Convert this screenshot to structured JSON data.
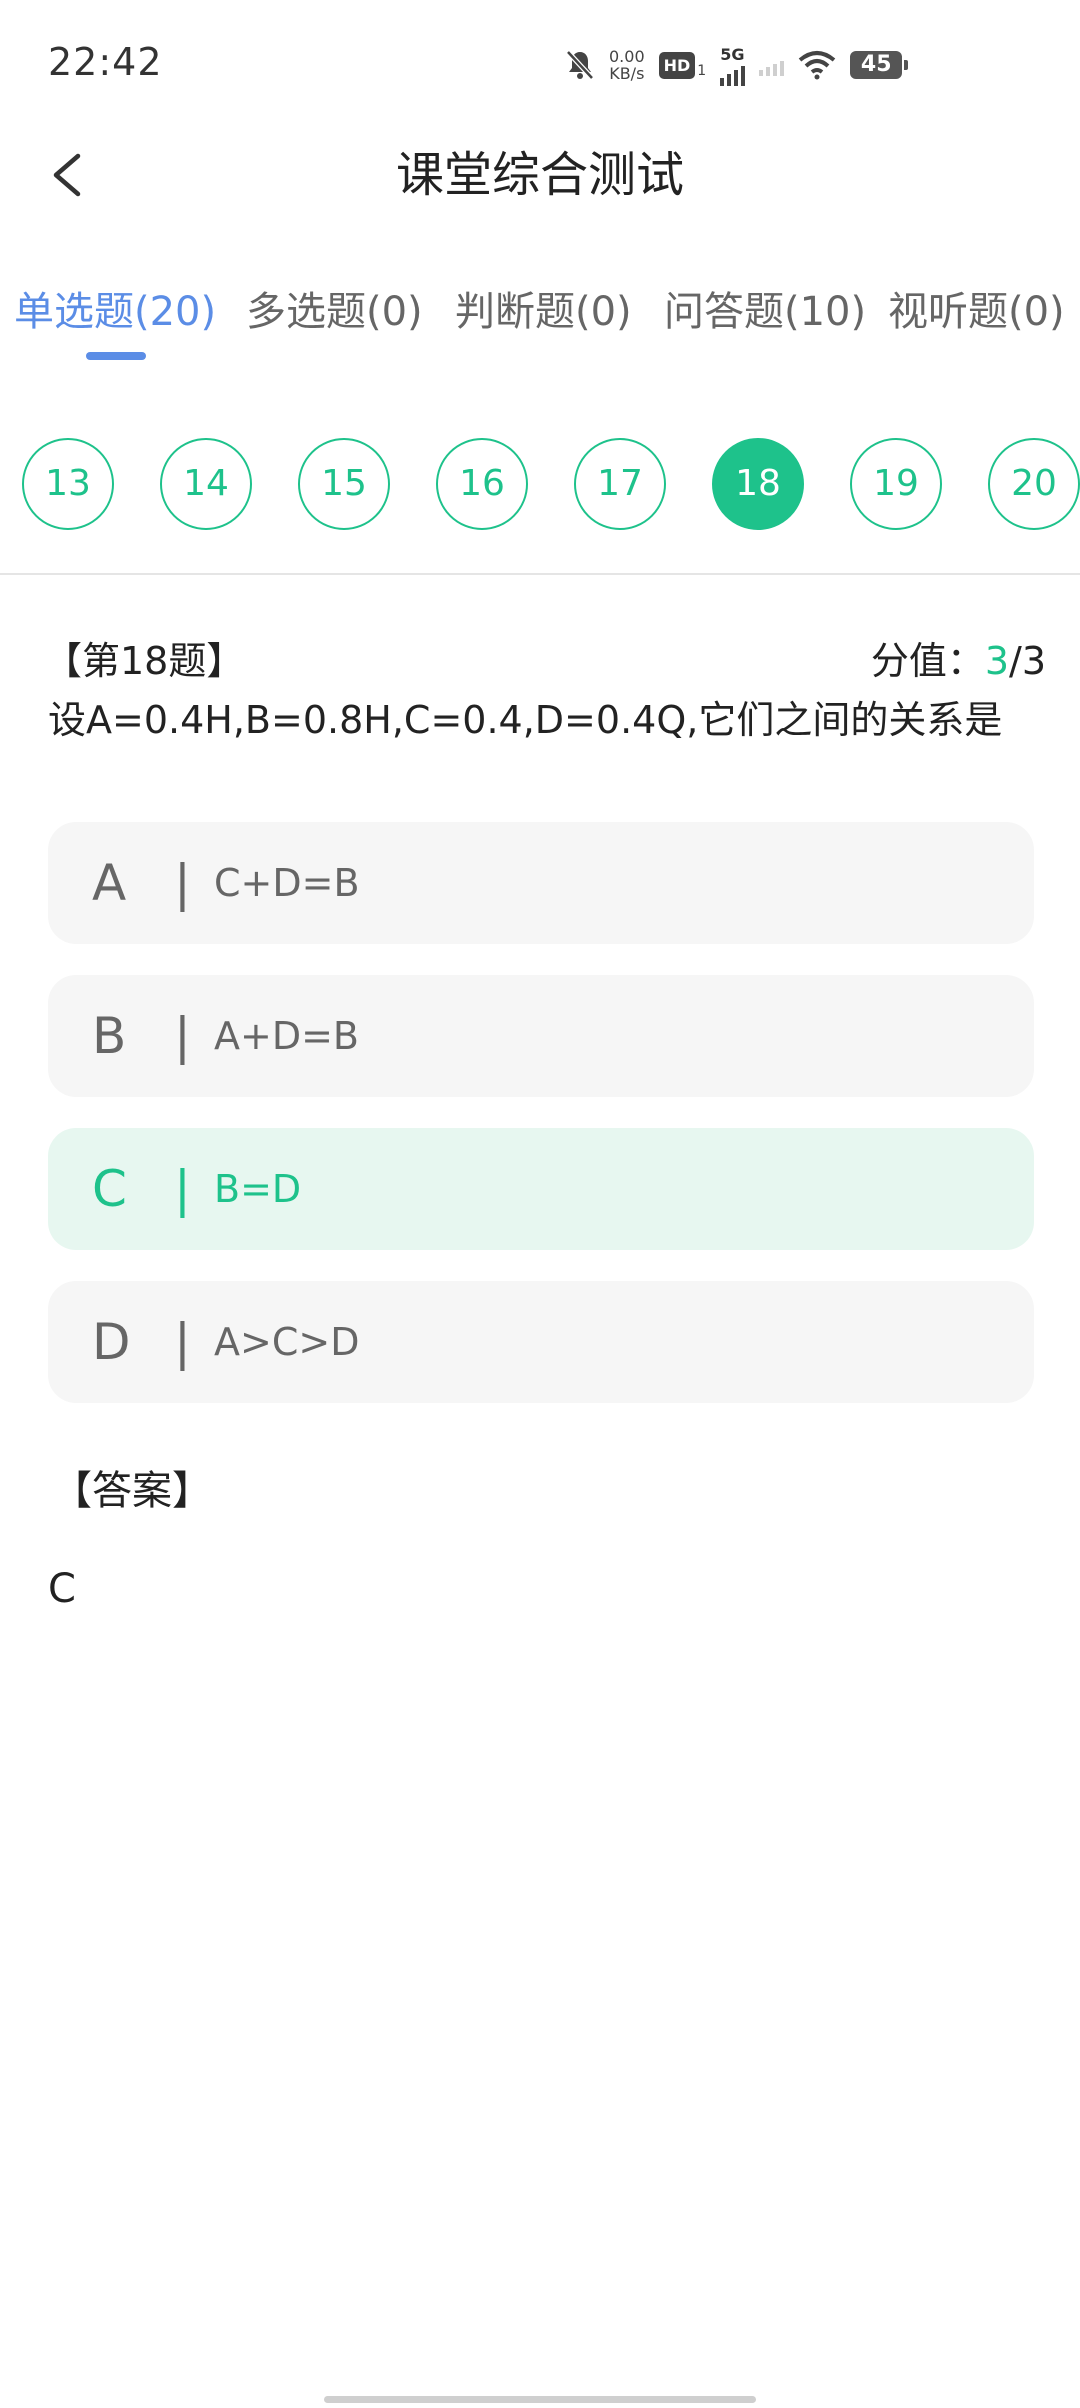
{
  "status_bar": {
    "time": "22:42",
    "speed_value": "0.00",
    "speed_unit": "KB/s",
    "hd_label": "HD",
    "hd_sub": "1",
    "network": "5G",
    "battery": "45"
  },
  "header": {
    "title": "课堂综合测试"
  },
  "tabs": [
    {
      "label": "单选题(20)",
      "active": true
    },
    {
      "label": "多选题(0)"
    },
    {
      "label": "判断题(0)"
    },
    {
      "label": "问答题(10)"
    },
    {
      "label": "视听题(0)"
    }
  ],
  "question_numbers": [
    "13",
    "14",
    "15",
    "16",
    "17",
    "18",
    "19",
    "20"
  ],
  "active_question": "18",
  "question": {
    "number_label": "【第18题】",
    "score_label": "分值：",
    "score_earned": "3",
    "score_total": "/3",
    "text": "设A=0.4H,B=0.8H,C=0.4,D=0.4Q,它们之间的关系是"
  },
  "options": [
    {
      "letter": "A",
      "sep": "|",
      "text": "C+D=B",
      "selected": false
    },
    {
      "letter": "B",
      "sep": "|",
      "text": "A+D=B",
      "selected": false
    },
    {
      "letter": "C",
      "sep": "|",
      "text": "B=D",
      "selected": true
    },
    {
      "letter": "D",
      "sep": "|",
      "text": "A>C>D",
      "selected": false
    }
  ],
  "answer": {
    "label": "【答案】",
    "value": "C"
  },
  "colors": {
    "accent_green": "#1ec28b",
    "tab_blue": "#5b8de6",
    "selected_bg": "#e7f7f0",
    "option_bg": "#f6f6f6"
  }
}
